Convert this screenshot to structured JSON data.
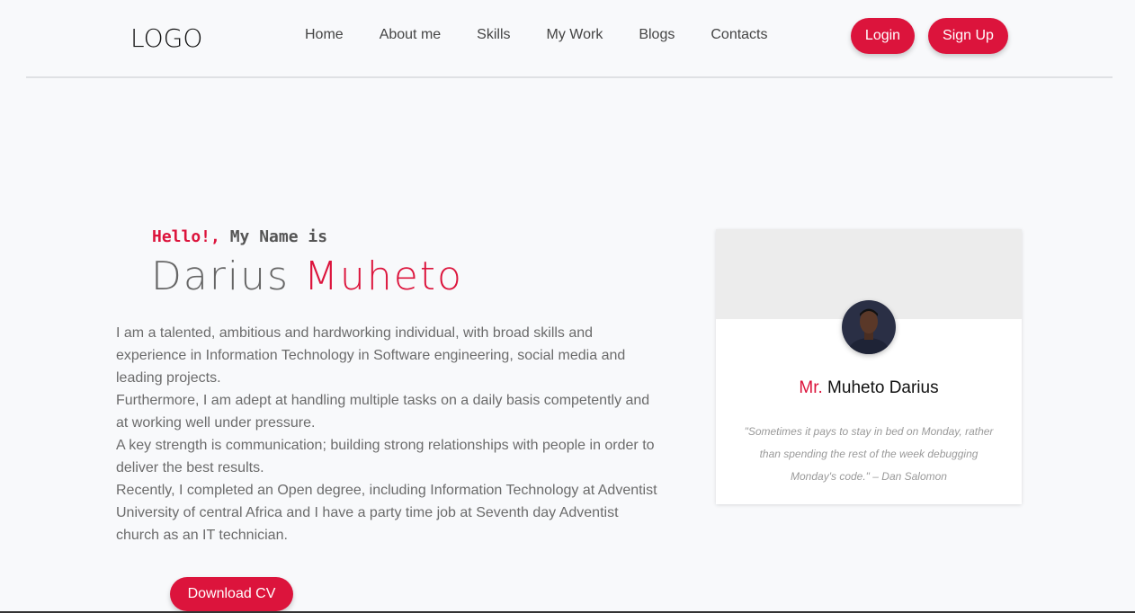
{
  "brand": {
    "logo": "LOGO"
  },
  "nav": {
    "links": [
      "Home",
      "About me",
      "Skills",
      "My Work",
      "Blogs",
      "Contacts"
    ],
    "login_label": "Login",
    "signup_label": "Sign Up"
  },
  "hero": {
    "greeting_accent": "Hello!,",
    "greeting_rest": " My Name is",
    "first_name": "Darius",
    "last_name": "Muheto",
    "bio": [
      "I am a talented, ambitious and hardworking individual, with broad skills and experience in Information Technology in Software engineering, social media and leading projects.",
      "Furthermore, I am adept at handling multiple tasks on a daily basis competently and at working well under pressure.",
      "A key strength is communication; building strong relationships with people in order to deliver the best results.",
      "Recently, I completed an Open degree, including Information Technology at Adventist University of central Africa and I have a party time job at Seventh day Adventist church as an IT technician."
    ],
    "cv_label": "Download CV"
  },
  "profile_card": {
    "title_prefix": "Mr.",
    "name": " Muheto Darius",
    "quote": "\"Sometimes it pays to stay in bed on Monday, rather than spending the rest of the week debugging Monday's code.\" – Dan Salomon"
  },
  "colors": {
    "accent": "#dc143c",
    "background": "#f8f9fb"
  }
}
